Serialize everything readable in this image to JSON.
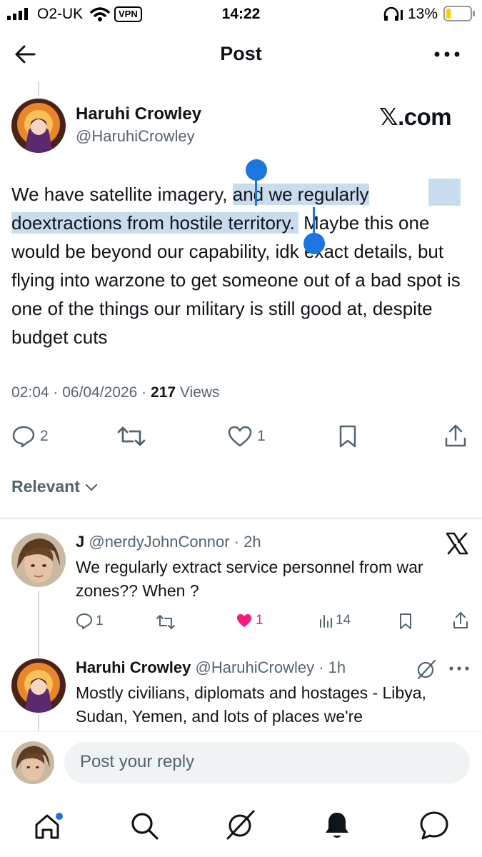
{
  "status_bar": {
    "carrier": "O2-UK",
    "vpn": "VPN",
    "time": "14:22",
    "battery": "13%"
  },
  "header": {
    "title": "Post",
    "back_icon": "arrow-left-icon",
    "more_icon": "more-dots-icon"
  },
  "post": {
    "author_name": "Haruhi Crowley",
    "author_handle": "@HaruhiCrowley",
    "watermark": ".com",
    "text_before": "We have satellite imagery, ",
    "text_selected_1": "and we regularly do",
    "text_selected_2": "extractions from hostile territory.",
    "text_after": " Maybe this one would be beyond our capability, idk exact details, but flying into warzone to get someone out of a bad spot is one of the things our military is still good at, despite budget cuts",
    "time": "02:04",
    "date": "06/04/2026",
    "views_count": "217",
    "views_label": "Views",
    "replies": "2",
    "likes": "1"
  },
  "sort": {
    "label": "Relevant"
  },
  "replies": [
    {
      "name": "J",
      "handle": "@nerdyJohnConnor",
      "age": "2h",
      "text": "We regularly extract service personnel from war zones?? When ?",
      "replies": "1",
      "likes": "1",
      "views": "14"
    },
    {
      "name": "Haruhi Crowley",
      "handle": "@HaruhiCrowley",
      "age": "1h",
      "text": "Mostly civilians, diplomats and hostages - Libya, Sudan, Yemen, and lots of places we're"
    }
  ],
  "composer": {
    "placeholder": "Post your reply"
  },
  "colors": {
    "accent": "#1d75e0",
    "like": "#f91880",
    "secondary_text": "#536471",
    "selection": "#c9dcee"
  }
}
